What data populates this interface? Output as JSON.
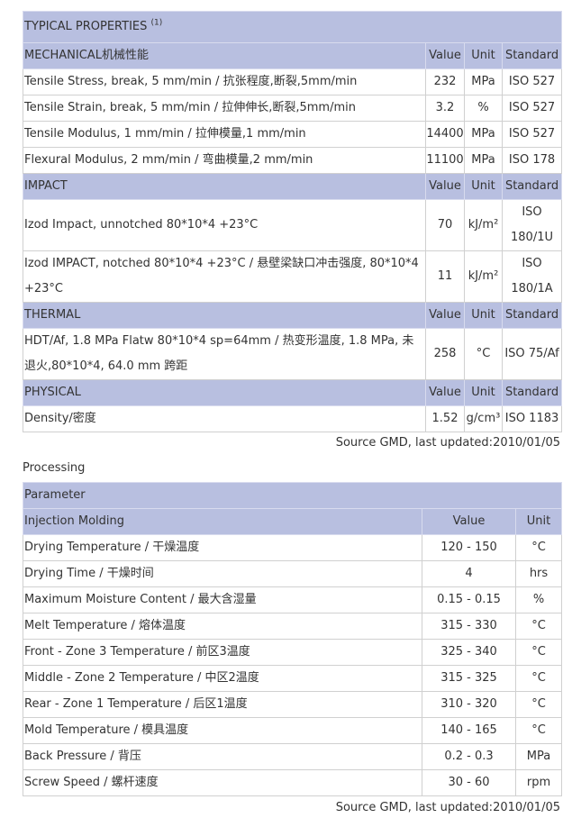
{
  "properties": {
    "title": "TYPICAL PROPERTIES",
    "title_note": "(1)",
    "col_value": "Value",
    "col_unit": "Unit",
    "col_standard": "Standard",
    "sections": [
      {
        "name": "MECHANICAL机械性能",
        "rows": [
          {
            "label": "Tensile Stress, break, 5 mm/min / 抗张程度,断裂,5mm/min",
            "value": "232",
            "unit": "MPa",
            "standard": "ISO 527"
          },
          {
            "label": "Tensile Strain, break, 5 mm/min / 拉伸伸长,断裂,5mm/min",
            "value": "3.2",
            "unit": "%",
            "standard": "ISO 527"
          },
          {
            "label": "Tensile Modulus, 1 mm/min / 拉伸模量,1 mm/min",
            "value": "14400",
            "unit": "MPa",
            "standard": "ISO 527"
          },
          {
            "label": "Flexural Modulus, 2 mm/min / 弯曲模量,2 mm/min",
            "value": "11100",
            "unit": "MPa",
            "standard": "ISO 178"
          }
        ]
      },
      {
        "name": "IMPACT",
        "rows": [
          {
            "label": "Izod Impact, unnotched 80*10*4 +23°C",
            "value": "70",
            "unit": "kJ/m²",
            "standard": "ISO 180/1U"
          },
          {
            "label": "Izod IMPACT, notched 80*10*4 +23°C / 悬壁梁缺口冲击强度, 80*10*4 +23°C",
            "value": "11",
            "unit": "kJ/m²",
            "standard": "ISO 180/1A"
          }
        ]
      },
      {
        "name": "THERMAL",
        "rows": [
          {
            "label": "HDT/Af, 1.8 MPa Flatw 80*10*4 sp=64mm / 热变形温度, 1.8 MPa, 未退火,80*10*4, 64.0 mm 跨距",
            "value": "258",
            "unit": "°C",
            "standard": "ISO 75/Af"
          }
        ]
      },
      {
        "name": "PHYSICAL",
        "rows": [
          {
            "label": "Density/密度",
            "value": "1.52",
            "unit": "g/cm³",
            "standard": "ISO 1183"
          }
        ]
      }
    ],
    "source": "Source GMD, last updated:2010/01/05"
  },
  "processing": {
    "label": "Processing",
    "parameter": "Parameter",
    "group": "Injection Molding",
    "col_value": "Value",
    "col_unit": "Unit",
    "rows": [
      {
        "label": "Drying Temperature / 干燥温度",
        "value": "120 - 150",
        "unit": "°C"
      },
      {
        "label": "Drying Time / 干燥时间",
        "value": "4",
        "unit": "hrs"
      },
      {
        "label": "Maximum Moisture Content / 最大含湿量",
        "value": "0.15 - 0.15",
        "unit": "%"
      },
      {
        "label": "Melt Temperature / 熔体温度",
        "value": "315 - 330",
        "unit": "°C"
      },
      {
        "label": "Front - Zone 3 Temperature / 前区3温度",
        "value": "325 - 340",
        "unit": "°C"
      },
      {
        "label": "Middle - Zone 2 Temperature / 中区2温度",
        "value": "315 - 325",
        "unit": "°C"
      },
      {
        "label": "Rear - Zone 1 Temperature / 后区1温度",
        "value": "310 - 320",
        "unit": "°C"
      },
      {
        "label": "Mold Temperature / 模具温度",
        "value": "140 - 165",
        "unit": "°C"
      },
      {
        "label": "Back Pressure / 背压",
        "value": "0.2 - 0.3",
        "unit": "MPa"
      },
      {
        "label": "Screw Speed / 螺杆速度",
        "value": "30 - 60",
        "unit": "rpm"
      }
    ],
    "source": "Source GMD, last updated:2010/01/05"
  }
}
